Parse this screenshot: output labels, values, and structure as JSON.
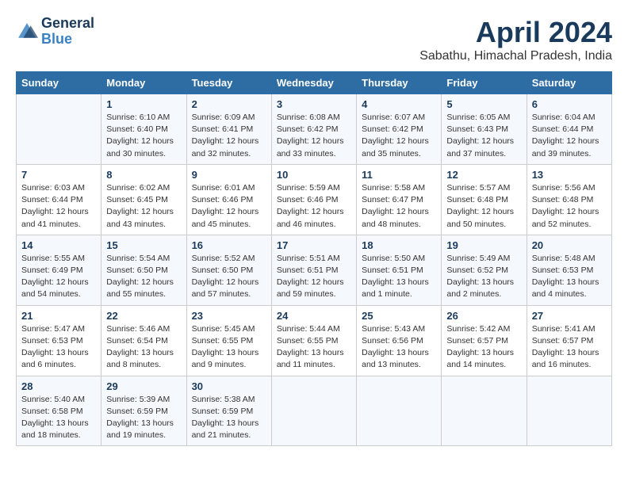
{
  "header": {
    "logo_line1": "General",
    "logo_line2": "Blue",
    "month_year": "April 2024",
    "location": "Sabathu, Himachal Pradesh, India"
  },
  "columns": [
    "Sunday",
    "Monday",
    "Tuesday",
    "Wednesday",
    "Thursday",
    "Friday",
    "Saturday"
  ],
  "weeks": [
    [
      {
        "day": "",
        "info": ""
      },
      {
        "day": "1",
        "info": "Sunrise: 6:10 AM\nSunset: 6:40 PM\nDaylight: 12 hours\nand 30 minutes."
      },
      {
        "day": "2",
        "info": "Sunrise: 6:09 AM\nSunset: 6:41 PM\nDaylight: 12 hours\nand 32 minutes."
      },
      {
        "day": "3",
        "info": "Sunrise: 6:08 AM\nSunset: 6:42 PM\nDaylight: 12 hours\nand 33 minutes."
      },
      {
        "day": "4",
        "info": "Sunrise: 6:07 AM\nSunset: 6:42 PM\nDaylight: 12 hours\nand 35 minutes."
      },
      {
        "day": "5",
        "info": "Sunrise: 6:05 AM\nSunset: 6:43 PM\nDaylight: 12 hours\nand 37 minutes."
      },
      {
        "day": "6",
        "info": "Sunrise: 6:04 AM\nSunset: 6:44 PM\nDaylight: 12 hours\nand 39 minutes."
      }
    ],
    [
      {
        "day": "7",
        "info": "Sunrise: 6:03 AM\nSunset: 6:44 PM\nDaylight: 12 hours\nand 41 minutes."
      },
      {
        "day": "8",
        "info": "Sunrise: 6:02 AM\nSunset: 6:45 PM\nDaylight: 12 hours\nand 43 minutes."
      },
      {
        "day": "9",
        "info": "Sunrise: 6:01 AM\nSunset: 6:46 PM\nDaylight: 12 hours\nand 45 minutes."
      },
      {
        "day": "10",
        "info": "Sunrise: 5:59 AM\nSunset: 6:46 PM\nDaylight: 12 hours\nand 46 minutes."
      },
      {
        "day": "11",
        "info": "Sunrise: 5:58 AM\nSunset: 6:47 PM\nDaylight: 12 hours\nand 48 minutes."
      },
      {
        "day": "12",
        "info": "Sunrise: 5:57 AM\nSunset: 6:48 PM\nDaylight: 12 hours\nand 50 minutes."
      },
      {
        "day": "13",
        "info": "Sunrise: 5:56 AM\nSunset: 6:48 PM\nDaylight: 12 hours\nand 52 minutes."
      }
    ],
    [
      {
        "day": "14",
        "info": "Sunrise: 5:55 AM\nSunset: 6:49 PM\nDaylight: 12 hours\nand 54 minutes."
      },
      {
        "day": "15",
        "info": "Sunrise: 5:54 AM\nSunset: 6:50 PM\nDaylight: 12 hours\nand 55 minutes."
      },
      {
        "day": "16",
        "info": "Sunrise: 5:52 AM\nSunset: 6:50 PM\nDaylight: 12 hours\nand 57 minutes."
      },
      {
        "day": "17",
        "info": "Sunrise: 5:51 AM\nSunset: 6:51 PM\nDaylight: 12 hours\nand 59 minutes."
      },
      {
        "day": "18",
        "info": "Sunrise: 5:50 AM\nSunset: 6:51 PM\nDaylight: 13 hours\nand 1 minute."
      },
      {
        "day": "19",
        "info": "Sunrise: 5:49 AM\nSunset: 6:52 PM\nDaylight: 13 hours\nand 2 minutes."
      },
      {
        "day": "20",
        "info": "Sunrise: 5:48 AM\nSunset: 6:53 PM\nDaylight: 13 hours\nand 4 minutes."
      }
    ],
    [
      {
        "day": "21",
        "info": "Sunrise: 5:47 AM\nSunset: 6:53 PM\nDaylight: 13 hours\nand 6 minutes."
      },
      {
        "day": "22",
        "info": "Sunrise: 5:46 AM\nSunset: 6:54 PM\nDaylight: 13 hours\nand 8 minutes."
      },
      {
        "day": "23",
        "info": "Sunrise: 5:45 AM\nSunset: 6:55 PM\nDaylight: 13 hours\nand 9 minutes."
      },
      {
        "day": "24",
        "info": "Sunrise: 5:44 AM\nSunset: 6:55 PM\nDaylight: 13 hours\nand 11 minutes."
      },
      {
        "day": "25",
        "info": "Sunrise: 5:43 AM\nSunset: 6:56 PM\nDaylight: 13 hours\nand 13 minutes."
      },
      {
        "day": "26",
        "info": "Sunrise: 5:42 AM\nSunset: 6:57 PM\nDaylight: 13 hours\nand 14 minutes."
      },
      {
        "day": "27",
        "info": "Sunrise: 5:41 AM\nSunset: 6:57 PM\nDaylight: 13 hours\nand 16 minutes."
      }
    ],
    [
      {
        "day": "28",
        "info": "Sunrise: 5:40 AM\nSunset: 6:58 PM\nDaylight: 13 hours\nand 18 minutes."
      },
      {
        "day": "29",
        "info": "Sunrise: 5:39 AM\nSunset: 6:59 PM\nDaylight: 13 hours\nand 19 minutes."
      },
      {
        "day": "30",
        "info": "Sunrise: 5:38 AM\nSunset: 6:59 PM\nDaylight: 13 hours\nand 21 minutes."
      },
      {
        "day": "",
        "info": ""
      },
      {
        "day": "",
        "info": ""
      },
      {
        "day": "",
        "info": ""
      },
      {
        "day": "",
        "info": ""
      }
    ]
  ]
}
